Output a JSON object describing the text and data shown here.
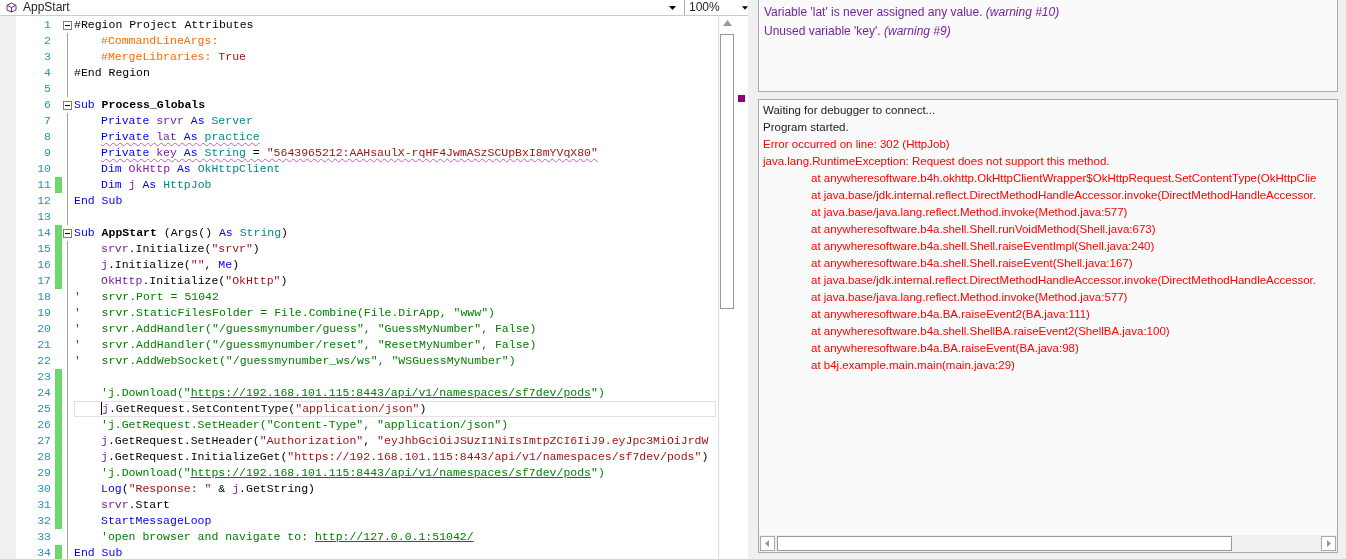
{
  "toolbar": {
    "module": "AppStart",
    "zoom": "100%"
  },
  "editor": {
    "lines": [
      {
        "number": "1",
        "changed": false,
        "foldable": true,
        "indented": false,
        "squiggle": false,
        "current": false,
        "tokens": [
          {
            "kind": "plain",
            "text": "#Region Project Attributes"
          }
        ]
      },
      {
        "number": "2",
        "changed": false,
        "foldable": false,
        "indented": true,
        "squiggle": false,
        "current": false,
        "tokens": [
          {
            "kind": "dir",
            "text": "#CommandLineArgs:"
          }
        ]
      },
      {
        "number": "3",
        "changed": false,
        "foldable": false,
        "indented": true,
        "squiggle": false,
        "current": false,
        "tokens": [
          {
            "kind": "dir",
            "text": "#MergeLibraries:"
          },
          {
            "kind": "str",
            "text": " True"
          }
        ]
      },
      {
        "number": "4",
        "changed": false,
        "foldable": false,
        "indented": false,
        "squiggle": false,
        "current": false,
        "tokens": [
          {
            "kind": "plain",
            "text": "#End Region"
          }
        ]
      },
      {
        "number": "5",
        "changed": false,
        "foldable": false,
        "indented": false,
        "squiggle": false,
        "current": false
      },
      {
        "number": "6",
        "changed": false,
        "foldable": true,
        "indented": false,
        "squiggle": false,
        "current": false,
        "tokens": [
          {
            "kind": "kw",
            "text": "Sub"
          },
          {
            "kind": "name",
            "text": " Process_Globals"
          }
        ]
      },
      {
        "number": "7",
        "changed": false,
        "foldable": false,
        "indented": true,
        "squiggle": false,
        "current": false,
        "tokens": [
          {
            "kind": "kw",
            "text": "Private"
          },
          {
            "kind": "var",
            "text": " srvr"
          },
          {
            "kind": "kw",
            "text": " As"
          },
          {
            "kind": "type",
            "text": " Server"
          }
        ]
      },
      {
        "number": "8",
        "changed": false,
        "foldable": false,
        "indented": true,
        "squiggle": true,
        "current": false,
        "tokens": [
          {
            "kind": "kw",
            "text": "Private"
          },
          {
            "kind": "var",
            "text": " lat"
          },
          {
            "kind": "kw",
            "text": " As"
          },
          {
            "kind": "type",
            "text": " practice"
          }
        ]
      },
      {
        "number": "9",
        "changed": false,
        "foldable": false,
        "indented": true,
        "squiggle": true,
        "current": false,
        "tokens": [
          {
            "kind": "kw",
            "text": "Private"
          },
          {
            "kind": "var",
            "text": " key"
          },
          {
            "kind": "kw",
            "text": " As"
          },
          {
            "kind": "type",
            "text": " String"
          },
          {
            "kind": "plain",
            "text": " = "
          },
          {
            "kind": "str",
            "text": "\"5643965212:AAHsaulX-rqHF4JwmASzSCUpBxI8mYVqX80\""
          }
        ]
      },
      {
        "number": "10",
        "changed": false,
        "foldable": false,
        "indented": true,
        "squiggle": false,
        "current": false,
        "tokens": [
          {
            "kind": "kw",
            "text": "Dim"
          },
          {
            "kind": "var",
            "text": " OkHttp"
          },
          {
            "kind": "kw",
            "text": " As"
          },
          {
            "kind": "type",
            "text": " OkHttpClient"
          }
        ]
      },
      {
        "number": "11",
        "changed": true,
        "foldable": false,
        "indented": true,
        "squiggle": false,
        "current": false,
        "tokens": [
          {
            "kind": "kw",
            "text": "Dim"
          },
          {
            "kind": "var",
            "text": " j"
          },
          {
            "kind": "kw",
            "text": " As"
          },
          {
            "kind": "type",
            "text": " HttpJob"
          }
        ]
      },
      {
        "number": "12",
        "changed": false,
        "foldable": false,
        "indented": false,
        "squiggle": false,
        "current": false,
        "tokens": [
          {
            "kind": "kw",
            "text": "End Sub"
          }
        ]
      },
      {
        "number": "13",
        "changed": false,
        "foldable": false,
        "indented": false,
        "squiggle": false,
        "current": false
      },
      {
        "number": "14",
        "changed": true,
        "foldable": true,
        "indented": false,
        "squiggle": false,
        "current": false,
        "tokens": [
          {
            "kind": "kw",
            "text": "Sub"
          },
          {
            "kind": "name",
            "text": " AppStart"
          },
          {
            "kind": "plain",
            "text": " (Args() "
          },
          {
            "kind": "kw",
            "text": "As"
          },
          {
            "kind": "type",
            "text": " String"
          },
          {
            "kind": "plain",
            "text": ")"
          }
        ]
      },
      {
        "number": "15",
        "changed": true,
        "foldable": false,
        "indented": true,
        "squiggle": false,
        "current": false,
        "tokens": [
          {
            "kind": "var",
            "text": "srvr"
          },
          {
            "kind": "plain",
            "text": ".Initialize("
          },
          {
            "kind": "str",
            "text": "\"srvr\""
          },
          {
            "kind": "plain",
            "text": ")"
          }
        ]
      },
      {
        "number": "16",
        "changed": true,
        "foldable": false,
        "indented": true,
        "squiggle": false,
        "current": false,
        "tokens": [
          {
            "kind": "var",
            "text": "j"
          },
          {
            "kind": "plain",
            "text": ".Initialize("
          },
          {
            "kind": "str",
            "text": "\"\""
          },
          {
            "kind": "plain",
            "text": ", "
          },
          {
            "kind": "kw",
            "text": "Me"
          },
          {
            "kind": "plain",
            "text": ")"
          }
        ]
      },
      {
        "number": "17",
        "changed": true,
        "foldable": false,
        "indented": true,
        "squiggle": false,
        "current": false,
        "tokens": [
          {
            "kind": "var",
            "text": "OkHttp"
          },
          {
            "kind": "plain",
            "text": ".Initialize("
          },
          {
            "kind": "str",
            "text": "\"OkHttp\""
          },
          {
            "kind": "plain",
            "text": ")"
          }
        ]
      },
      {
        "number": "18",
        "changed": false,
        "foldable": false,
        "indented": false,
        "squiggle": false,
        "current": false,
        "tokens": [
          {
            "kind": "cmt",
            "text": "'   srvr.Port = 51042"
          }
        ]
      },
      {
        "number": "19",
        "changed": false,
        "foldable": false,
        "indented": false,
        "squiggle": false,
        "current": false,
        "tokens": [
          {
            "kind": "cmt",
            "text": "'   srvr.StaticFilesFolder = File.Combine(File.DirApp, \"www\")"
          }
        ]
      },
      {
        "number": "20",
        "changed": false,
        "foldable": false,
        "indented": false,
        "squiggle": false,
        "current": false,
        "tokens": [
          {
            "kind": "cmt",
            "text": "'   srvr.AddHandler(\"/guessmynumber/guess\", \"GuessMyNumber\", False)"
          }
        ]
      },
      {
        "number": "21",
        "changed": false,
        "foldable": false,
        "indented": false,
        "squiggle": false,
        "current": false,
        "tokens": [
          {
            "kind": "cmt",
            "text": "'   srvr.AddHandler(\"/guessmynumber/reset\", \"ResetMyNumber\", False)"
          }
        ]
      },
      {
        "number": "22",
        "changed": false,
        "foldable": false,
        "indented": false,
        "squiggle": false,
        "current": false,
        "tokens": [
          {
            "kind": "cmt",
            "text": "'   srvr.AddWebSocket(\"/guessmynumber_ws/ws\", \"WSGuessMyNumber\")"
          }
        ]
      },
      {
        "number": "23",
        "changed": true,
        "foldable": false,
        "indented": false,
        "squiggle": false,
        "current": false
      },
      {
        "number": "24",
        "changed": true,
        "foldable": false,
        "indented": true,
        "squiggle": false,
        "current": false,
        "tokens": [
          {
            "kind": "cmt",
            "text": "'j.Download(\""
          },
          {
            "kind": "link",
            "text": "https://192.168.101.115:8443/api/v1/namespaces/sf7dev/pods"
          },
          {
            "kind": "cmt",
            "text": "\")"
          }
        ]
      },
      {
        "number": "25",
        "changed": true,
        "foldable": false,
        "indented": true,
        "squiggle": false,
        "current": true,
        "tokens": [
          {
            "kind": "var",
            "text": "j"
          },
          {
            "kind": "plain",
            "text": ".GetRequest.SetContentType("
          },
          {
            "kind": "str",
            "text": "\"application/json\""
          },
          {
            "kind": "plain",
            "text": ")"
          }
        ]
      },
      {
        "number": "26",
        "changed": true,
        "foldable": false,
        "indented": true,
        "squiggle": false,
        "current": false,
        "tokens": [
          {
            "kind": "cmt",
            "text": "'j.GetRequest.SetHeader(\"Content-Type\", \"application/json\")"
          }
        ]
      },
      {
        "number": "27",
        "changed": true,
        "foldable": false,
        "indented": true,
        "squiggle": false,
        "current": false,
        "tokens": [
          {
            "kind": "var",
            "text": "j"
          },
          {
            "kind": "plain",
            "text": ".GetRequest.SetHeader("
          },
          {
            "kind": "str",
            "text": "\"Authorization\""
          },
          {
            "kind": "plain",
            "text": ", "
          },
          {
            "kind": "str",
            "text": "\"eyJhbGciOiJSUzI1NiIsImtpZCI6IiJ9.eyJpc3MiOiJrdW"
          }
        ]
      },
      {
        "number": "28",
        "changed": true,
        "foldable": false,
        "indented": true,
        "squiggle": false,
        "current": false,
        "tokens": [
          {
            "kind": "var",
            "text": "j"
          },
          {
            "kind": "plain",
            "text": ".GetRequest.InitializeGet("
          },
          {
            "kind": "str",
            "text": "\"https://192.168.101.115:8443/api/v1/namespaces/sf7dev/pods\""
          },
          {
            "kind": "plain",
            "text": ")"
          }
        ]
      },
      {
        "number": "29",
        "changed": true,
        "foldable": false,
        "indented": true,
        "squiggle": false,
        "current": false,
        "tokens": [
          {
            "kind": "cmt",
            "text": "'j.Download(\""
          },
          {
            "kind": "link",
            "text": "https://192.168.101.115:8443/api/v1/namespaces/sf7dev/pods"
          },
          {
            "kind": "cmt",
            "text": "\")"
          }
        ]
      },
      {
        "number": "30",
        "changed": true,
        "foldable": false,
        "indented": true,
        "squiggle": false,
        "current": false,
        "tokens": [
          {
            "kind": "kw",
            "text": "Log"
          },
          {
            "kind": "plain",
            "text": "("
          },
          {
            "kind": "str",
            "text": "\"Response: \""
          },
          {
            "kind": "plain",
            "text": " & "
          },
          {
            "kind": "var",
            "text": "j"
          },
          {
            "kind": "plain",
            "text": ".GetString)"
          }
        ]
      },
      {
        "number": "31",
        "changed": true,
        "foldable": false,
        "indented": true,
        "squiggle": false,
        "current": false,
        "tokens": [
          {
            "kind": "var",
            "text": "srvr"
          },
          {
            "kind": "plain",
            "text": ".Start"
          }
        ]
      },
      {
        "number": "32",
        "changed": true,
        "foldable": false,
        "indented": true,
        "squiggle": false,
        "current": false,
        "tokens": [
          {
            "kind": "kw",
            "text": "StartMessageLoop"
          }
        ]
      },
      {
        "number": "33",
        "changed": false,
        "foldable": false,
        "indented": true,
        "squiggle": false,
        "current": false,
        "tokens": [
          {
            "kind": "cmt",
            "text": "'open browser and navigate to: "
          },
          {
            "kind": "link",
            "text": "http://127.0.0.1:51042/"
          }
        ]
      },
      {
        "number": "34",
        "changed": true,
        "foldable": false,
        "indented": false,
        "squiggle": false,
        "current": false,
        "tokens": [
          {
            "kind": "kw",
            "text": "End Sub"
          }
        ]
      }
    ]
  },
  "warnings": [
    "Variable 'lat' is never assigned any value. *(warning #10)*",
    "Unused variable 'key'. *(warning #9)*"
  ],
  "log": [
    {
      "kind": "info",
      "text": "Waiting for debugger to connect..."
    },
    {
      "kind": "info",
      "text": "Program started."
    },
    {
      "kind": "error",
      "text": "Error occurred on line: 302 (HttpJob)"
    },
    {
      "kind": "error",
      "text": "java.lang.RuntimeException: Request does not support this method."
    },
    {
      "kind": "trace",
      "text": "at anywheresoftware.b4h.okhttp.OkHttpClientWrapper$OkHttpRequest.SetContentType(OkHttpClie"
    },
    {
      "kind": "trace",
      "text": "at java.base/jdk.internal.reflect.DirectMethodHandleAccessor.invoke(DirectMethodHandleAccessor."
    },
    {
      "kind": "trace",
      "text": "at java.base/java.lang.reflect.Method.invoke(Method.java:577)"
    },
    {
      "kind": "trace",
      "text": "at anywheresoftware.b4a.shell.Shell.runVoidMethod(Shell.java:673)"
    },
    {
      "kind": "trace",
      "text": "at anywheresoftware.b4a.shell.Shell.raiseEventImpl(Shell.java:240)"
    },
    {
      "kind": "trace",
      "text": "at anywheresoftware.b4a.shell.Shell.raiseEvent(Shell.java:167)"
    },
    {
      "kind": "trace",
      "text": "at java.base/jdk.internal.reflect.DirectMethodHandleAccessor.invoke(DirectMethodHandleAccessor."
    },
    {
      "kind": "trace",
      "text": "at java.base/java.lang.reflect.Method.invoke(Method.java:577)"
    },
    {
      "kind": "trace",
      "text": "at anywheresoftware.b4a.BA.raiseEvent2(BA.java:111)"
    },
    {
      "kind": "trace",
      "text": "at anywheresoftware.b4a.shell.ShellBA.raiseEvent2(ShellBA.java:100)"
    },
    {
      "kind": "trace",
      "text": "at anywheresoftware.b4a.BA.raiseEvent(BA.java:98)"
    },
    {
      "kind": "trace",
      "text": "at b4j.example.main.main(main.java:29)"
    }
  ]
}
